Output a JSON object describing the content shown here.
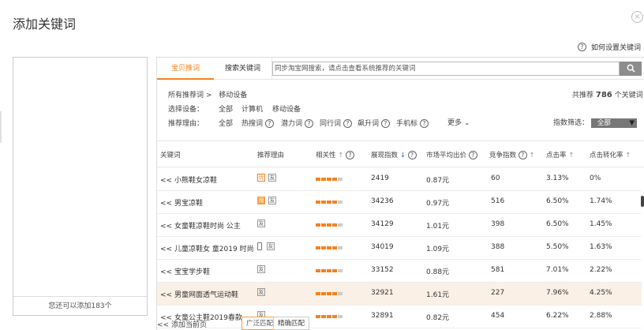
{
  "dialog": {
    "title": "添加关键词",
    "close_glyph": "×",
    "help_text": "如何设置关键词"
  },
  "left_panel": {
    "footer_text": "您还可以添加183个"
  },
  "tabs": [
    {
      "label": "宝贝推词"
    },
    {
      "label": "搜索关键词"
    }
  ],
  "search": {
    "placeholder": "同步淘宝网搜索，请点击查看系统推荐的关键词"
  },
  "breadcrumb": {
    "root": "所有推荐词 >",
    "current": "移动设备"
  },
  "summary": {
    "prefix": "共推荐",
    "count": "786",
    "suffix": "个关键词"
  },
  "device_filter": {
    "label": "选择设备：",
    "options": [
      "全部",
      "计算机",
      "移动设备"
    ]
  },
  "reason_filter": {
    "label": "推荐理由：",
    "options": [
      "全部",
      "热搜词",
      "潜力词",
      "同行词",
      "飙升词",
      "手机标"
    ],
    "more": "更多"
  },
  "index_filter": {
    "label": "指数筛选：",
    "value": "全部"
  },
  "table": {
    "headers": [
      "关键词",
      "推荐理由",
      "相关性",
      "展现指数",
      "市场平均出价",
      "竞争指数",
      "点击率",
      "点击转化率"
    ],
    "rows": [
      {
        "keyword": "<< 小熊鞋女凉鞋",
        "reasons": [
          "优",
          "友"
        ],
        "impressions": "2419",
        "avg_bid": "0.87元",
        "competition": "60",
        "ctr": "3.13%",
        "cvr": "0%"
      },
      {
        "keyword": "<< 男宝凉鞋",
        "reasons": [
          "用",
          "友"
        ],
        "impressions": "34236",
        "avg_bid": "0.97元",
        "competition": "516",
        "ctr": "6.50%",
        "cvr": "1.74%"
      },
      {
        "keyword": "<< 女童鞋凉鞋时尚 公主",
        "reasons": [
          "友"
        ],
        "impressions": "34129",
        "avg_bid": "1.01元",
        "competition": "398",
        "ctr": "6.50%",
        "cvr": "1.45%"
      },
      {
        "keyword": "<< 儿童凉鞋女 童2019 时尚",
        "reasons": [
          "友"
        ],
        "phone": true,
        "impressions": "34019",
        "avg_bid": "1.09元",
        "competition": "388",
        "ctr": "5.50%",
        "cvr": "1.63%"
      },
      {
        "keyword": "<< 宝宝学步鞋",
        "reasons": [
          "友"
        ],
        "impressions": "33152",
        "avg_bid": "0.88元",
        "competition": "581",
        "ctr": "7.01%",
        "cvr": "2.22%"
      },
      {
        "keyword": "<< 男童网面透气运动鞋",
        "reasons": [
          "友"
        ],
        "impressions": "32921",
        "avg_bid": "1.61元",
        "competition": "227",
        "ctr": "7.96%",
        "cvr": "4.25%"
      },
      {
        "keyword": "<< 女童公主鞋2019春款",
        "reasons": [
          "友"
        ],
        "impressions": "32891",
        "avg_bid": "0.82元",
        "competition": "454",
        "ctr": "6.22%",
        "cvr": "2.88%"
      }
    ]
  },
  "footer": {
    "add_page": "<< 添加当前页",
    "broad": "广泛匹配",
    "exact": "精确匹配"
  },
  "colors": {
    "accent": "#f5821f",
    "relevance_bar": "#f5821f",
    "relevance_empty": "#cccccc"
  }
}
